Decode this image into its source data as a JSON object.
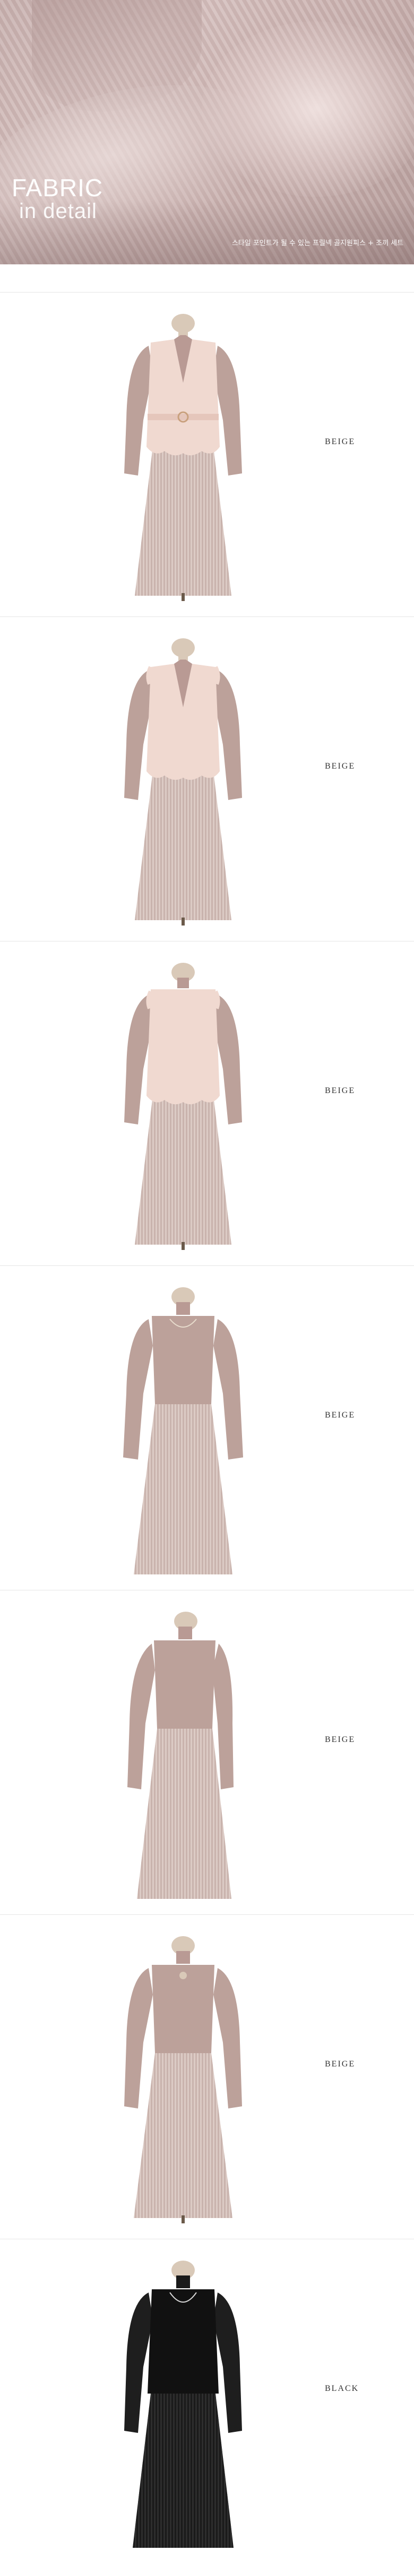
{
  "fabric": {
    "title_line1": "FABRIC",
    "title_line2": "in detail",
    "caption": "스타일 포인트가 될 수 있는 프릴넥 골지원피스 + 조끼 세트"
  },
  "colors": {
    "beige_top": "#f0d9d0",
    "mauve": "#b99a94",
    "mesh": "#dbc9c3",
    "black": "#1a1a1a"
  },
  "sections": [
    {
      "color_label": "BEIGE",
      "variant": "vest-belt-front"
    },
    {
      "color_label": "BEIGE",
      "variant": "vest-front"
    },
    {
      "color_label": "BEIGE",
      "variant": "vest-back"
    },
    {
      "color_label": "BEIGE",
      "variant": "dress-front"
    },
    {
      "color_label": "BEIGE",
      "variant": "dress-side"
    },
    {
      "color_label": "BEIGE",
      "variant": "dress-back"
    },
    {
      "color_label": "BLACK",
      "variant": "black-front"
    }
  ]
}
